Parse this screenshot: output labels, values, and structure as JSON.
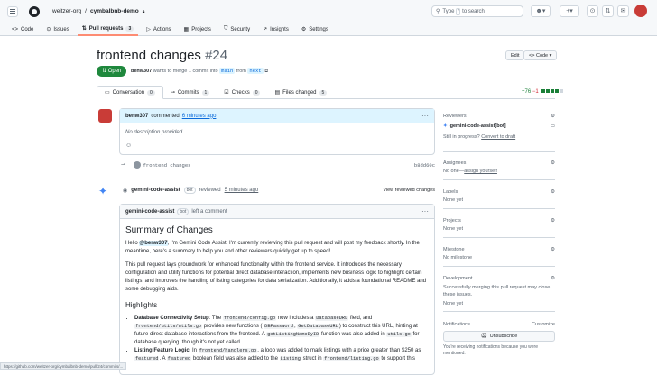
{
  "header": {
    "owner": "weitzer-org",
    "repo": "cymbalbnb-demo",
    "search_placeholder": "Type / to search"
  },
  "repo_tabs": [
    {
      "icon": "code-icon",
      "label": "Code"
    },
    {
      "icon": "issues-icon",
      "label": "Issues"
    },
    {
      "icon": "pull-request-icon",
      "label": "Pull requests",
      "count": "3"
    },
    {
      "icon": "actions-icon",
      "label": "Actions"
    },
    {
      "icon": "projects-icon",
      "label": "Projects"
    },
    {
      "icon": "security-icon",
      "label": "Security"
    },
    {
      "icon": "insights-icon",
      "label": "Insights"
    },
    {
      "icon": "settings-icon",
      "label": "Settings"
    }
  ],
  "pr": {
    "title": "frontend changes",
    "number": "#24",
    "edit_label": "Edit",
    "code_label": "Code",
    "state": "Open",
    "author": "benw307",
    "meta_text": "wants to merge 1 commit into",
    "base": "main",
    "from_text": "from",
    "head": "next"
  },
  "pr_tabs": [
    {
      "label": "Conversation",
      "count": "0"
    },
    {
      "label": "Commits",
      "count": "1"
    },
    {
      "label": "Checks",
      "count": "0"
    },
    {
      "label": "Files changed",
      "count": "5"
    }
  ],
  "diffstat": {
    "plus": "+76",
    "minus": "−1"
  },
  "comment1": {
    "author": "benw307",
    "action": "commented",
    "time": "6 minutes ago",
    "body": "No description provided."
  },
  "commit": {
    "message": "frontend changes",
    "sha": "b8dd60c"
  },
  "review": {
    "author": "gemini-code-assist",
    "bot": "bot",
    "action": "reviewed",
    "time": "5 minutes ago",
    "view_label": "View reviewed changes"
  },
  "comment2": {
    "author": "gemini-code-assist",
    "bot": "bot",
    "action": "left a comment",
    "heading": "Summary of Changes",
    "mention": "@benw307",
    "intro_rest": ", I'm Gemini Code Assist! I'm currently reviewing this pull request and will post my feedback shortly. In the meantime, here's a summary to help you and other reviewers quickly get up to speed!",
    "hello": "Hello",
    "para": "This pull request lays groundwork for enhanced functionality within the frontend service. It introduces the necessary configuration and utility functions for potential direct database interaction, implements new business logic to highlight certain listings, and improves the handling of listing categories for data serialization. Additionally, it adds a foundational README and some debugging aids.",
    "highlights_heading": "Highlights",
    "b1_label": "Database Connectivity Setup",
    "b1_t1": ": The",
    "b1_c1": "frontend/config.go",
    "b1_t2": "now includes a",
    "b1_c2": "DatabaseURL",
    "b1_t3": "field, and",
    "b1_c3": "frontend/utils/utils.go",
    "b1_t4": "provides new functions (",
    "b1_c4": "DBPassword",
    "b1_t5": ",",
    "b1_c5": "GetDatabaseURL",
    "b1_t6": ") to construct this URL, hinting at future direct database interactions from the frontend. A",
    "b1_c6": "getListingNameByID",
    "b1_t7": "function was also added in",
    "b1_c7": "utils.go",
    "b1_t8": "for database querying, though it's not yet called.",
    "b2_label": "Listing Feature Logic",
    "b2_t1": ": In",
    "b2_c1": "frontend/handlers.go",
    "b2_t2": ", a loop was added to mark listings with a price greater than $250 as",
    "b2_c2": "featured",
    "b2_t3": ". A",
    "b2_c3": "featured",
    "b2_t4": "boolean field was also added to the",
    "b2_c4": "Listing",
    "b2_t5": "struct in",
    "b2_c5": "frontend/listing.go",
    "b2_t6": "to support this"
  },
  "sidebar": {
    "reviewers_title": "Reviewers",
    "reviewer": "gemini-code-assist[bot]",
    "still_in_progress": "Still in progress?",
    "convert_draft": "Convert to draft",
    "assignees_title": "Assignees",
    "assignees_val": "No one—",
    "assign_yourself": "assign yourself",
    "labels_title": "Labels",
    "labels_val": "None yet",
    "projects_title": "Projects",
    "projects_val": "None yet",
    "milestone_title": "Milestone",
    "milestone_val": "No milestone",
    "development_title": "Development",
    "development_val": "Successfully merging this pull request may close these issues.",
    "development_none": "None yet",
    "notifications_title": "Notifications",
    "customize": "Customize",
    "unsubscribe": "Unsubscribe",
    "notif_reason": "You're receiving notifications because you were mentioned."
  },
  "status_url": "https://github.com/weitzer-org/cymbalbnb-demo/pull/24/commits/..."
}
